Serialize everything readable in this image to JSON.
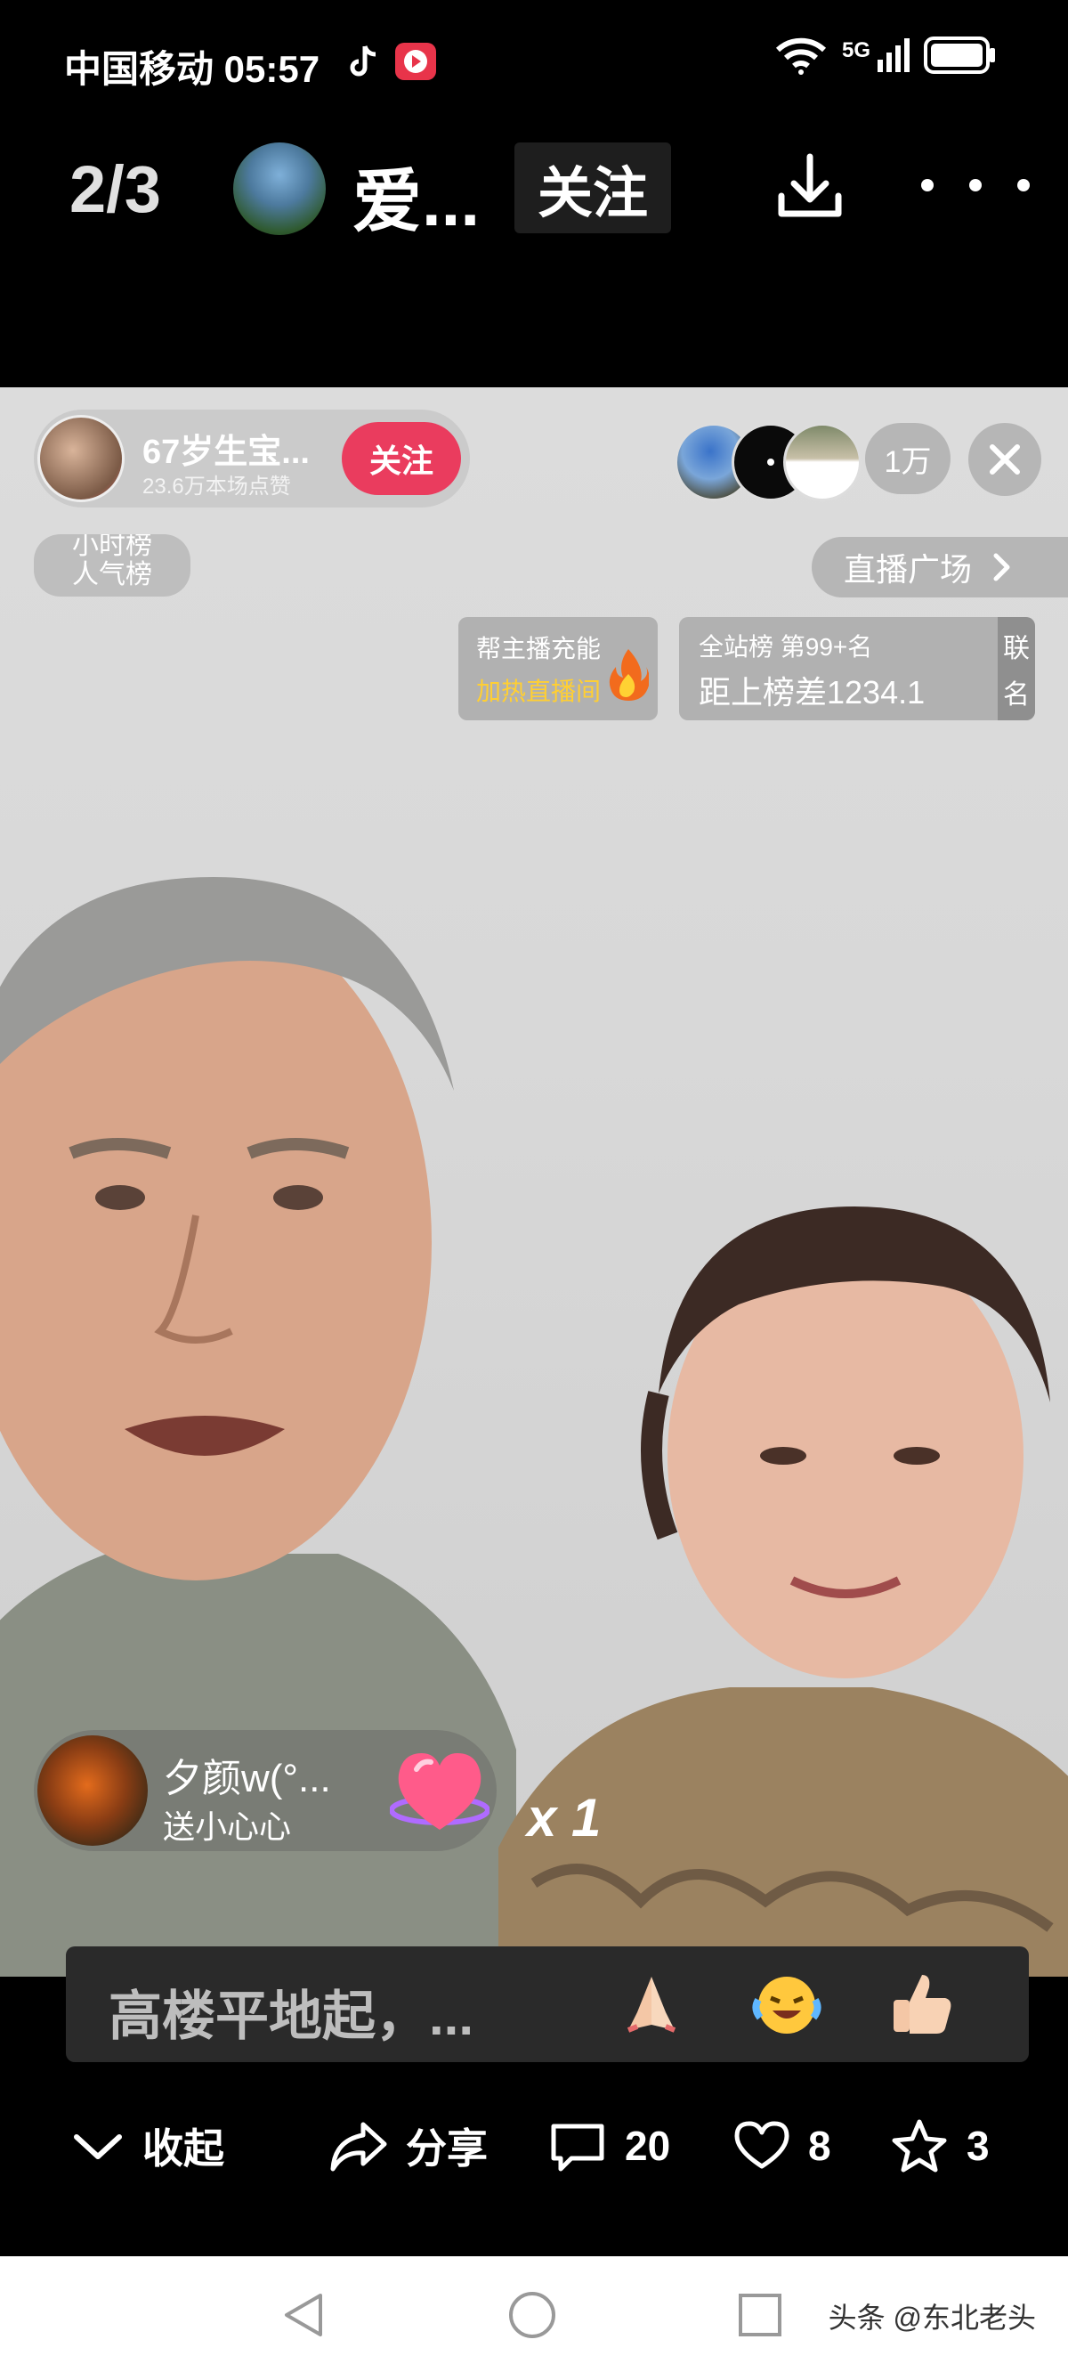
{
  "status_bar": {
    "carrier_time": "中国移动 05:57",
    "network": "5G"
  },
  "header": {
    "index": "2/3",
    "author_name": "爱...",
    "follow_label": "关注"
  },
  "live": {
    "host_name": "67岁生宝...",
    "host_likes": "23.6万本场点赞",
    "host_follow_label": "关注",
    "viewer_count": "1万",
    "rank_pill_lines": [
      "小时榜",
      "人气榜"
    ],
    "plaza_label": "直播广场",
    "charge_title": "帮主播充能",
    "charge_sub": "加热直播间",
    "rank_title": "全站榜 第99+名",
    "rank_diff": "距上榜差1234.1",
    "rank_side": [
      "联",
      "名"
    ],
    "gift_user": "夕颜w(°...",
    "gift_action": "送小心心",
    "gift_count": "x 1"
  },
  "comment": {
    "text": "高楼平地起，..."
  },
  "actions": {
    "collapse_label": "收起",
    "share_label": "分享",
    "comment_count": "20",
    "like_count": "8",
    "favorite_count": "3"
  },
  "watermark": "头条 @东北老头",
  "colors": {
    "follow_red": "#ea3c5e",
    "gold": "#ffcf33"
  }
}
